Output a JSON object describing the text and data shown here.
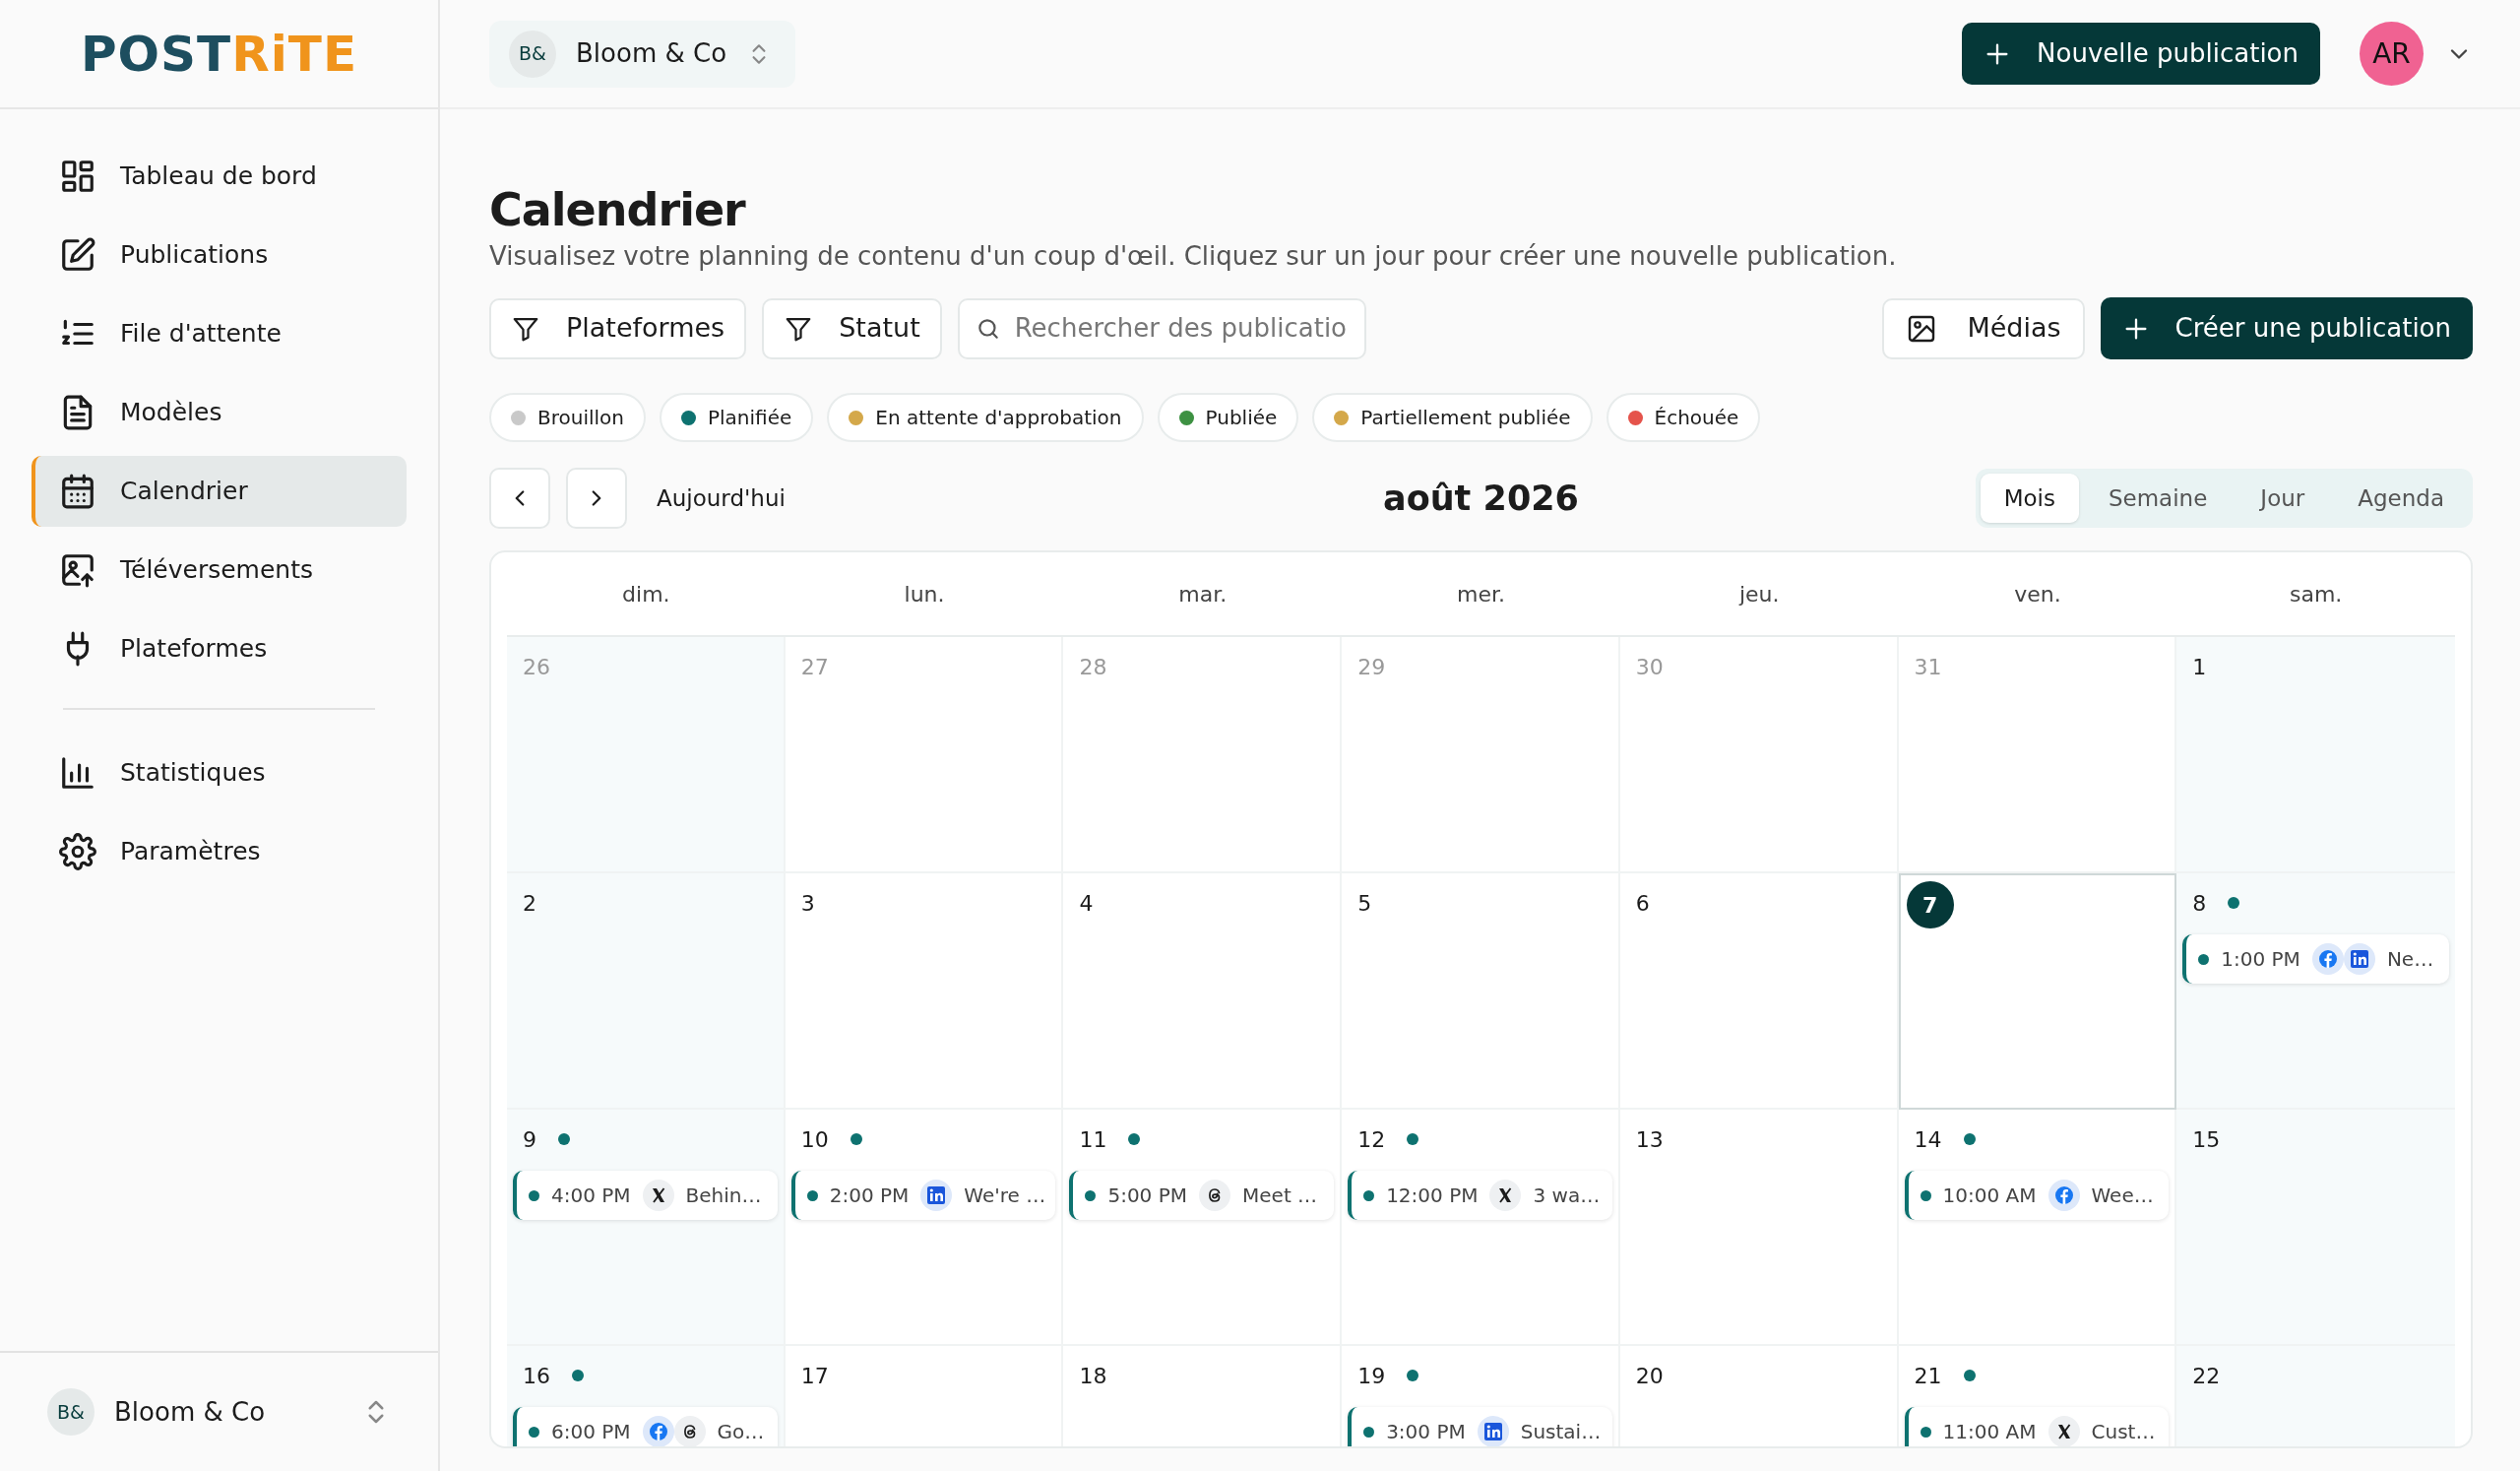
{
  "logo": {
    "first": "POST",
    "second": "RiTE"
  },
  "sidebar": {
    "sections": [
      [
        {
          "label": "Tableau de bord",
          "kind": "grid",
          "selected": false
        },
        {
          "label": "Publications",
          "kind": "edit",
          "selected": false
        },
        {
          "label": "File d'attente",
          "kind": "queue",
          "selected": false
        },
        {
          "label": "Modèles",
          "kind": "document",
          "selected": false
        },
        {
          "label": "Calendrier",
          "kind": "calendar",
          "selected": true
        },
        {
          "label": "Téléversements",
          "kind": "upload",
          "selected": false
        },
        {
          "label": "Plateformes",
          "kind": "plug",
          "selected": false
        }
      ],
      [
        {
          "label": "Statistiques",
          "kind": "chart",
          "selected": false
        },
        {
          "label": "Paramètres",
          "kind": "gear",
          "selected": false
        }
      ]
    ],
    "workspace": {
      "initials": "B&",
      "name": "Bloom & Co"
    }
  },
  "header": {
    "workspace": {
      "initials": "B&",
      "name": "Bloom & Co"
    },
    "new_button": "Nouvelle publication",
    "avatar": "AR"
  },
  "page": {
    "title": "Calendrier",
    "subtitle": "Visualisez votre planning de contenu d'un coup d'œil. Cliquez sur un jour pour créer une nouvelle publication.",
    "filters": [
      "Plateformes",
      "Statut"
    ],
    "search": {
      "placeholder": "Rechercher des publicatio"
    },
    "media_button": "Médias",
    "create_button": "Créer une publication",
    "legend": [
      {
        "label": "Brouillon",
        "color": "#c9c9c9"
      },
      {
        "label": "Planifiée",
        "color": "#0e7270"
      },
      {
        "label": "En attente d'approbation",
        "color": "#d4a84a"
      },
      {
        "label": "Publiée",
        "color": "#3d9142"
      },
      {
        "label": "Partiellement publiée",
        "color": "#d4a84a"
      },
      {
        "label": "Échouée",
        "color": "#e5534b"
      }
    ],
    "today_button": "Aujourd'hui",
    "month": "août 2026",
    "views": [
      {
        "label": "Mois",
        "selected": true
      },
      {
        "label": "Semaine",
        "selected": false
      },
      {
        "label": "Jour",
        "selected": false
      },
      {
        "label": "Agenda",
        "selected": false
      }
    ]
  },
  "calendar": {
    "weekdays": [
      "dim.",
      "lun.",
      "mar.",
      "mer.",
      "jeu.",
      "ven.",
      "sam."
    ],
    "weeks": [
      [
        {
          "day": "26",
          "outside": true,
          "today": false
        },
        {
          "day": "27",
          "outside": true,
          "today": false
        },
        {
          "day": "28",
          "outside": true,
          "today": false
        },
        {
          "day": "29",
          "outside": true,
          "today": false
        },
        {
          "day": "30",
          "outside": true,
          "today": false
        },
        {
          "day": "31",
          "outside": true,
          "today": false
        },
        {
          "day": "1",
          "outside": false,
          "today": false
        }
      ],
      [
        {
          "day": "2",
          "outside": false,
          "today": false
        },
        {
          "day": "3",
          "outside": false,
          "today": false
        },
        {
          "day": "4",
          "outside": false,
          "today": false
        },
        {
          "day": "5",
          "outside": false,
          "today": false
        },
        {
          "day": "6",
          "outside": false,
          "today": false
        },
        {
          "day": "7",
          "outside": false,
          "today": true
        },
        {
          "day": "8",
          "outside": false,
          "today": false,
          "posts": [
            {
              "time": "1:00 PM",
              "platforms": [
                {
                  "kind": "facebook"
                },
                {
                  "kind": "linkedin"
                }
              ],
              "title": "Ne…",
              "color": "#0e7270"
            }
          ]
        }
      ],
      [
        {
          "day": "9",
          "outside": false,
          "today": false,
          "posts": [
            {
              "time": "4:00 PM",
              "platforms": [
                {
                  "kind": "x"
                }
              ],
              "title": "Behin…",
              "color": "#0e7270"
            }
          ]
        },
        {
          "day": "10",
          "outside": false,
          "today": false,
          "posts": [
            {
              "time": "2:00 PM",
              "platforms": [
                {
                  "kind": "linkedin"
                }
              ],
              "title": "We're …",
              "color": "#0e7270"
            }
          ]
        },
        {
          "day": "11",
          "outside": false,
          "today": false,
          "posts": [
            {
              "time": "5:00 PM",
              "platforms": [
                {
                  "kind": "threads"
                }
              ],
              "title": "Meet …",
              "color": "#0e7270"
            }
          ]
        },
        {
          "day": "12",
          "outside": false,
          "today": false,
          "posts": [
            {
              "time": "12:00 PM",
              "platforms": [
                {
                  "kind": "x"
                }
              ],
              "title": "3 wa…",
              "color": "#0e7270"
            }
          ]
        },
        {
          "day": "13",
          "outside": false,
          "today": false
        },
        {
          "day": "14",
          "outside": false,
          "today": false,
          "posts": [
            {
              "time": "10:00 AM",
              "platforms": [
                {
                  "kind": "facebook"
                }
              ],
              "title": "Wee…",
              "color": "#0e7270"
            }
          ]
        },
        {
          "day": "15",
          "outside": false,
          "today": false
        }
      ],
      [
        {
          "day": "16",
          "outside": false,
          "today": false,
          "posts": [
            {
              "time": "6:00 PM",
              "platforms": [
                {
                  "kind": "facebook"
                },
                {
                  "kind": "threads"
                }
              ],
              "title": "Go…",
              "color": "#0e7270"
            }
          ]
        },
        {
          "day": "17",
          "outside": false,
          "today": false
        },
        {
          "day": "18",
          "outside": false,
          "today": false
        },
        {
          "day": "19",
          "outside": false,
          "today": false,
          "posts": [
            {
              "time": "3:00 PM",
              "platforms": [
                {
                  "kind": "linkedin"
                }
              ],
              "title": "Sustai…",
              "color": "#0e7270"
            }
          ]
        },
        {
          "day": "20",
          "outside": false,
          "today": false
        },
        {
          "day": "21",
          "outside": false,
          "today": false,
          "posts": [
            {
              "time": "11:00 AM",
              "platforms": [
                {
                  "kind": "x"
                }
              ],
              "title": "Cust…",
              "color": "#0e7270"
            }
          ]
        },
        {
          "day": "22",
          "outside": false,
          "today": false
        }
      ]
    ]
  }
}
